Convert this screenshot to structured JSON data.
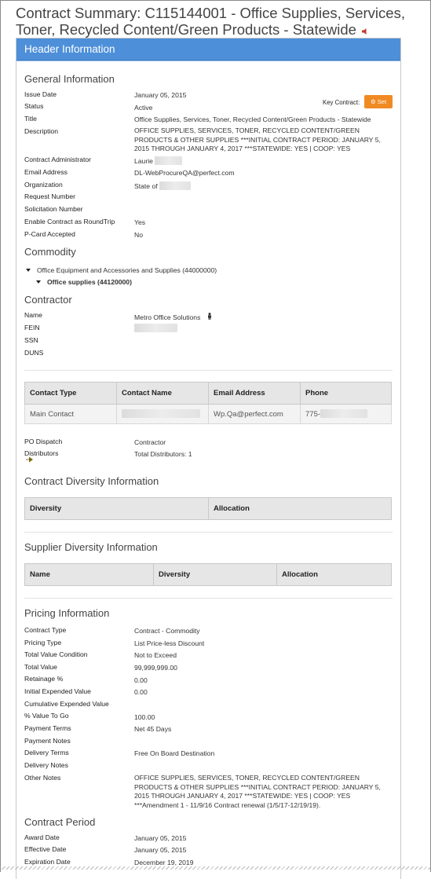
{
  "page_title": "Contract Summary:  C115144001 - Office Supplies, Services, Toner, Recycled Content/Green Products - Statewide",
  "panel_title": "Header Information",
  "general": {
    "heading": "General Information",
    "key_contract_label": "Key Contract:",
    "set_label": "Set",
    "rows": [
      {
        "label": "Issue Date",
        "value": "January 05, 2015"
      },
      {
        "label": "Status",
        "value": "Active"
      },
      {
        "label": "Title",
        "value": "Office Supplies, Services, Toner, Recycled Content/Green Products - Statewide"
      },
      {
        "label": "Description",
        "value": "OFFICE SUPPLIES, SERVICES, TONER, RECYCLED CONTENT/GREEN PRODUCTS & OTHER SUPPLIES ***INITIAL CONTRACT PERIOD: JANUARY 5, 2015 THROUGH JANUARY 4, 2017 ***STATEWIDE: YES | COOP: YES"
      },
      {
        "label": "Contract Administrator",
        "value": "Laurie"
      },
      {
        "label": "Email Address",
        "value": "DL-WebProcureQA@perfect.com"
      },
      {
        "label": "Organization",
        "value": "State of"
      },
      {
        "label": "Request Number",
        "value": ""
      },
      {
        "label": "Solicitation Number",
        "value": ""
      },
      {
        "label": "Enable Contract as RoundTrip",
        "value": "Yes"
      },
      {
        "label": "P-Card Accepted",
        "value": "No"
      }
    ]
  },
  "commodity": {
    "heading": "Commodity",
    "parent": "Office Equipment and Accessories and Supplies (44000000)",
    "child": "Office supplies (44120000)"
  },
  "contractor": {
    "heading": "Contractor",
    "rows": [
      {
        "label": "Name",
        "value": "Metro Office Solutions"
      },
      {
        "label": "FEIN",
        "value": ""
      },
      {
        "label": "SSN",
        "value": ""
      },
      {
        "label": "DUNS",
        "value": ""
      }
    ],
    "contact_table": {
      "headers": [
        "Contact Type",
        "Contact Name",
        "Email Address",
        "Phone"
      ],
      "row": [
        "Main Contact",
        "",
        "Wp.Qa@perfect.com",
        "775-"
      ]
    },
    "po_dispatch_label": "PO Dispatch",
    "po_dispatch_value": "Contractor",
    "distributors_label": "Distributors",
    "distributors_value": "Total Distributors: 1"
  },
  "contract_diversity": {
    "heading": "Contract Diversity Information",
    "headers": [
      "Diversity",
      "Allocation"
    ]
  },
  "supplier_diversity": {
    "heading": "Supplier Diversity Information",
    "headers": [
      "Name",
      "Diversity",
      "Allocation"
    ]
  },
  "pricing": {
    "heading": "Pricing Information",
    "rows": [
      {
        "label": "Contract Type",
        "value": "Contract - Commodity"
      },
      {
        "label": "Pricing Type",
        "value": "List Price-less Discount"
      },
      {
        "label": "Total Value Condition",
        "value": "Not to Exceed"
      },
      {
        "label": "Total Value",
        "value": "99,999,999.00"
      },
      {
        "label": "Retainage %",
        "value": "0.00"
      },
      {
        "label": "Initial Expended Value",
        "value": "0.00"
      },
      {
        "label": "Cumulative Expended Value",
        "value": ""
      },
      {
        "label": "% Value To Go",
        "value": "100.00"
      },
      {
        "label": "Payment Terms",
        "value": "Net 45 Days"
      },
      {
        "label": "Payment Notes",
        "value": ""
      },
      {
        "label": "Delivery Terms",
        "value": "Free On Board Destination"
      },
      {
        "label": "Delivery Notes",
        "value": ""
      },
      {
        "label": "Other Notes",
        "value": "OFFICE SUPPLIES, SERVICES, TONER, RECYCLED CONTENT/GREEN PRODUCTS & OTHER SUPPLIES ***INITIAL CONTRACT PERIOD: JANUARY 5, 2015 THROUGH JANUARY 4, 2017 ***STATEWIDE: YES | COOP: YES ***Amendment 1 - 11/9/16 Contract renewal (1/5/17-12/19/19)."
      }
    ]
  },
  "period": {
    "heading": "Contract Period",
    "rows": [
      {
        "label": "Award Date",
        "value": "January 05, 2015"
      },
      {
        "label": "Effective Date",
        "value": "January 05, 2015"
      },
      {
        "label": "Expiration Date",
        "value": "December 19, 2019"
      }
    ]
  }
}
